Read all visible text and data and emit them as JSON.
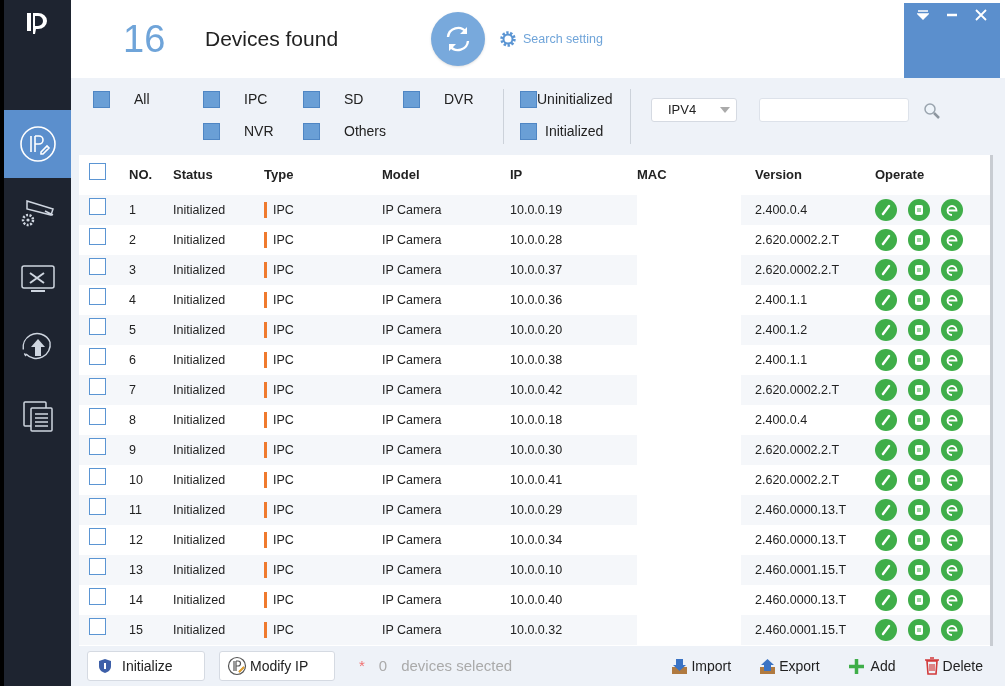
{
  "header": {
    "count": "16",
    "title": "Devices found",
    "search_setting": "Search setting"
  },
  "sidebar": {
    "items": [
      {
        "kind": "ip",
        "selected": true
      },
      {
        "kind": "camera",
        "selected": false
      },
      {
        "kind": "tools",
        "selected": false
      },
      {
        "kind": "upgrade",
        "selected": false
      },
      {
        "kind": "docs",
        "selected": false
      }
    ]
  },
  "filters": {
    "types": [
      {
        "label": "All",
        "checked": true
      },
      {
        "label": "IPC",
        "checked": true
      },
      {
        "label": "SD",
        "checked": true
      },
      {
        "label": "DVR",
        "checked": true
      },
      {
        "label": "NVR",
        "checked": true
      },
      {
        "label": "Others",
        "checked": true
      }
    ],
    "states": [
      {
        "label": "Uninitialized",
        "checked": true
      },
      {
        "label": "Initialized",
        "checked": true
      }
    ],
    "protocol": "IPV4"
  },
  "table": {
    "select_all": {
      "checked": false
    },
    "columns": [
      "NO.",
      "Status",
      "Type",
      "Model",
      "IP",
      "MAC",
      "Version",
      "Operate"
    ],
    "rows": [
      {
        "no": "1",
        "status": "Initialized",
        "type": "IPC",
        "model": "IP Camera",
        "ip": "10.0.0.19",
        "version": "2.400.0.4",
        "checked": false
      },
      {
        "no": "2",
        "status": "Initialized",
        "type": "IPC",
        "model": "IP Camera",
        "ip": "10.0.0.28",
        "version": "2.620.0002.2.T",
        "checked": false
      },
      {
        "no": "3",
        "status": "Initialized",
        "type": "IPC",
        "model": "IP Camera",
        "ip": "10.0.0.37",
        "version": "2.620.0002.2.T",
        "checked": false
      },
      {
        "no": "4",
        "status": "Initialized",
        "type": "IPC",
        "model": "IP Camera",
        "ip": "10.0.0.36",
        "version": "2.400.1.1",
        "checked": false
      },
      {
        "no": "5",
        "status": "Initialized",
        "type": "IPC",
        "model": "IP Camera",
        "ip": "10.0.0.20",
        "version": "2.400.1.2",
        "checked": false
      },
      {
        "no": "6",
        "status": "Initialized",
        "type": "IPC",
        "model": "IP Camera",
        "ip": "10.0.0.38",
        "version": "2.400.1.1",
        "checked": false
      },
      {
        "no": "7",
        "status": "Initialized",
        "type": "IPC",
        "model": "IP Camera",
        "ip": "10.0.0.42",
        "version": "2.620.0002.2.T",
        "checked": false
      },
      {
        "no": "8",
        "status": "Initialized",
        "type": "IPC",
        "model": "IP Camera",
        "ip": "10.0.0.18",
        "version": "2.400.0.4",
        "checked": false
      },
      {
        "no": "9",
        "status": "Initialized",
        "type": "IPC",
        "model": "IP Camera",
        "ip": "10.0.0.30",
        "version": "2.620.0002.2.T",
        "checked": false
      },
      {
        "no": "10",
        "status": "Initialized",
        "type": "IPC",
        "model": "IP Camera",
        "ip": "10.0.0.41",
        "version": "2.620.0002.2.T",
        "checked": false
      },
      {
        "no": "11",
        "status": "Initialized",
        "type": "IPC",
        "model": "IP Camera",
        "ip": "10.0.0.29",
        "version": "2.460.0000.13.T",
        "checked": false
      },
      {
        "no": "12",
        "status": "Initialized",
        "type": "IPC",
        "model": "IP Camera",
        "ip": "10.0.0.34",
        "version": "2.460.0000.13.T",
        "checked": false
      },
      {
        "no": "13",
        "status": "Initialized",
        "type": "IPC",
        "model": "IP Camera",
        "ip": "10.0.0.10",
        "version": "2.460.0001.15.T",
        "checked": false
      },
      {
        "no": "14",
        "status": "Initialized",
        "type": "IPC",
        "model": "IP Camera",
        "ip": "10.0.0.40",
        "version": "2.460.0000.13.T",
        "checked": false
      },
      {
        "no": "15",
        "status": "Initialized",
        "type": "IPC",
        "model": "IP Camera",
        "ip": "10.0.0.32",
        "version": "2.460.0001.15.T",
        "checked": false
      }
    ]
  },
  "footer": {
    "initialize": "Initialize",
    "modify_ip": "Modify IP",
    "asterisk": "*",
    "selected_count": "0",
    "selected_text": "devices selected",
    "import": "Import",
    "export": "Export",
    "add": "Add",
    "delete": "Delete"
  }
}
